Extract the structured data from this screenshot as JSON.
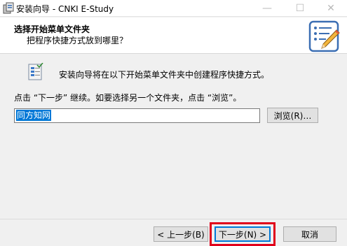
{
  "window": {
    "title": "安装向导 - CNKI E-Study",
    "app_icon": "setup-icon",
    "minimize_glyph": "—",
    "maximize_glyph": "☐",
    "close_glyph": "✕"
  },
  "header": {
    "title": "选择开始菜单文件夹",
    "subtitle": "把程序快捷方式放到哪里？",
    "icon": "notepad-pencil-icon"
  },
  "body": {
    "folder_icon": "start-menu-folder-icon",
    "info_text": "安装向导将在以下开始菜单文件夹中创建程序快捷方式。",
    "instruction": "点击 “下一步” 继续。如要选择另一个文件夹，点击 “浏览”。",
    "folder_input_value": "同方知网",
    "browse_label": "浏览(R)…"
  },
  "buttons": {
    "back": "< 上一步(B)",
    "next": "下一步(N) >",
    "cancel": "取消"
  },
  "colors": {
    "selection": "#0078d7",
    "highlight_box": "#e0001b",
    "dialog_bg": "#f0f0f0"
  }
}
